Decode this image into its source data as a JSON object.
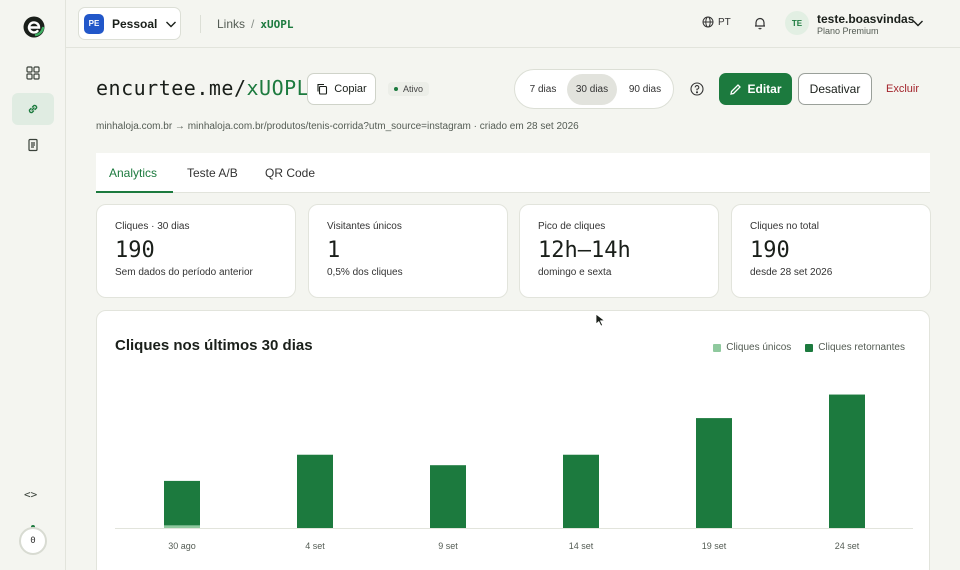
{
  "sidebar": {
    "items": [
      {
        "name": "dashboard",
        "icon": "grid-icon"
      },
      {
        "name": "links",
        "icon": "link-icon",
        "active": true
      },
      {
        "name": "documents",
        "icon": "document-icon"
      }
    ],
    "code_label": "<>",
    "credits": "0"
  },
  "topbar": {
    "workspace_badge": "PE",
    "workspace_name": "Pessoal",
    "breadcrumb_parent": "Links",
    "breadcrumb_sep": "/",
    "breadcrumb_current": "xUOPL",
    "language": "PT",
    "user_initials": "TE",
    "user_name": "teste.boasvindas",
    "user_plan": "Plano Premium"
  },
  "link": {
    "domain": "encurtee.me/",
    "slug": "xUOPL",
    "copy_label": "Copiar",
    "status": "Ativo",
    "destination": "minhaloja.com.br → minhaloja.com.br/produtos/tenis-corrida?utm_source=instagram · criado em 28 set 2026"
  },
  "periods": [
    {
      "label": "7 dias",
      "active": false
    },
    {
      "label": "30 dias",
      "active": true
    },
    {
      "label": "90 dias",
      "active": false
    }
  ],
  "actions": {
    "edit": "Editar",
    "deactivate": "Desativar",
    "delete": "Excluir"
  },
  "tabs": [
    {
      "label": "Analytics",
      "active": true
    },
    {
      "label": "Teste A/B",
      "active": false
    },
    {
      "label": "QR Code",
      "active": false
    }
  ],
  "stats": [
    {
      "label": "Cliques · 30 dias",
      "value": "190",
      "sub": "Sem dados do período anterior"
    },
    {
      "label": "Visitantes únicos",
      "value": "1",
      "sub": "0,5% dos cliques"
    },
    {
      "label": "Pico de cliques",
      "value": "12h–14h",
      "sub": "domingo e sexta"
    },
    {
      "label": "Cliques no total",
      "value": "190",
      "sub": "desde 28 set 2026"
    }
  ],
  "chart_data": {
    "type": "bar",
    "title": "Cliques nos últimos 30 dias",
    "categories": [
      "30 ago",
      "4 set",
      "9 set",
      "14 set",
      "19 set",
      "24 set"
    ],
    "series": [
      {
        "name": "Cliques únicos",
        "color": "#8fc99e",
        "values": [
          1,
          0,
          0,
          0,
          0,
          0
        ]
      },
      {
        "name": "Cliques retornantes",
        "color": "#1c7a3e",
        "values": [
          17,
          28,
          24,
          28,
          42,
          51
        ]
      }
    ],
    "stacked": true,
    "ylim": [
      0,
      60
    ],
    "grid": false,
    "legend": "top-right"
  },
  "colors": {
    "accent": "#1c7a3e",
    "danger": "#a3242c",
    "workspace": "#2257c9"
  }
}
